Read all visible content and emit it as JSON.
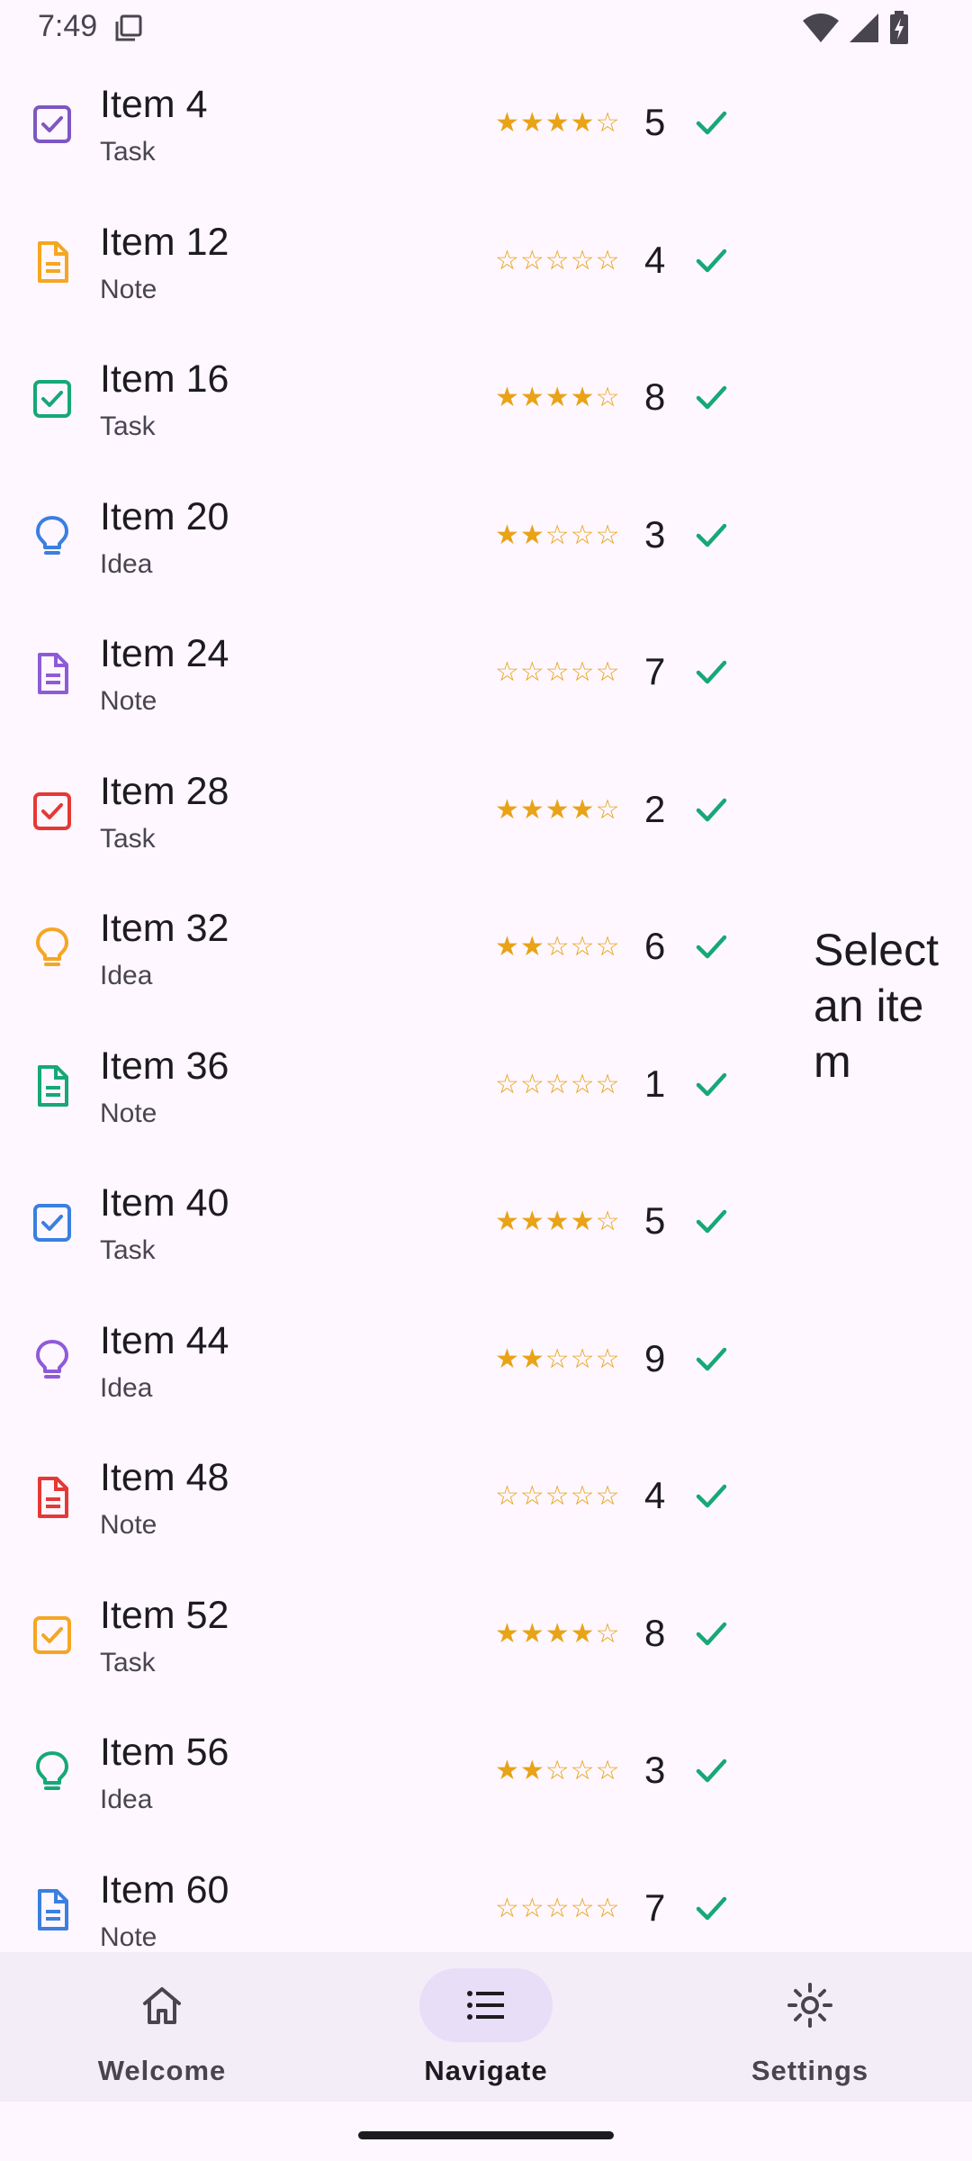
{
  "status_bar": {
    "time": "7:49",
    "icons": [
      "wifi-icon",
      "signal-icon",
      "battery-charging-icon"
    ]
  },
  "list": {
    "items": [
      {
        "title": "Item 4",
        "type": "Task",
        "icon": "checkbox-icon",
        "color": "#7E57C2",
        "stars": "★★★★☆",
        "count": "5"
      },
      {
        "title": "Item 12",
        "type": "Note",
        "icon": "note-icon",
        "color": "#F5A623",
        "stars": "☆☆☆☆☆",
        "count": "4"
      },
      {
        "title": "Item 16",
        "type": "Task",
        "icon": "checkbox-icon",
        "color": "#16A877",
        "stars": "★★★★☆",
        "count": "8"
      },
      {
        "title": "Item 20",
        "type": "Idea",
        "icon": "lightbulb-icon",
        "color": "#3B7FE0",
        "stars": "★★☆☆☆",
        "count": "3"
      },
      {
        "title": "Item 24",
        "type": "Note",
        "icon": "note-icon",
        "color": "#8E5BD8",
        "stars": "☆☆☆☆☆",
        "count": "7"
      },
      {
        "title": "Item 28",
        "type": "Task",
        "icon": "checkbox-icon",
        "color": "#E53935",
        "stars": "★★★★☆",
        "count": "2"
      },
      {
        "title": "Item 32",
        "type": "Idea",
        "icon": "lightbulb-icon",
        "color": "#F5A623",
        "stars": "★★☆☆☆",
        "count": "6"
      },
      {
        "title": "Item 36",
        "type": "Note",
        "icon": "note-icon",
        "color": "#16A877",
        "stars": "☆☆☆☆☆",
        "count": "1"
      },
      {
        "title": "Item 40",
        "type": "Task",
        "icon": "checkbox-icon",
        "color": "#3B7FE0",
        "stars": "★★★★☆",
        "count": "5"
      },
      {
        "title": "Item 44",
        "type": "Idea",
        "icon": "lightbulb-icon",
        "color": "#8E5BD8",
        "stars": "★★☆☆☆",
        "count": "9"
      },
      {
        "title": "Item 48",
        "type": "Note",
        "icon": "note-icon",
        "color": "#E53935",
        "stars": "☆☆☆☆☆",
        "count": "4"
      },
      {
        "title": "Item 52",
        "type": "Task",
        "icon": "checkbox-icon",
        "color": "#F5A623",
        "stars": "★★★★☆",
        "count": "8"
      },
      {
        "title": "Item 56",
        "type": "Idea",
        "icon": "lightbulb-icon",
        "color": "#16A877",
        "stars": "★★☆☆☆",
        "count": "3"
      },
      {
        "title": "Item 60",
        "type": "Note",
        "icon": "note-icon",
        "color": "#3B7FE0",
        "stars": "☆☆☆☆☆",
        "count": "7"
      }
    ],
    "star_color": "#E8A317",
    "check_color": "#16A877"
  },
  "detail": {
    "placeholder": "Select an item"
  },
  "bottom_nav": {
    "items": [
      {
        "label": "Welcome",
        "icon": "home-icon",
        "active": false
      },
      {
        "label": "Navigate",
        "icon": "list-icon",
        "active": true
      },
      {
        "label": "Settings",
        "icon": "sun-icon",
        "active": false
      }
    ],
    "active_indicator_color": "#E8DEF8"
  }
}
